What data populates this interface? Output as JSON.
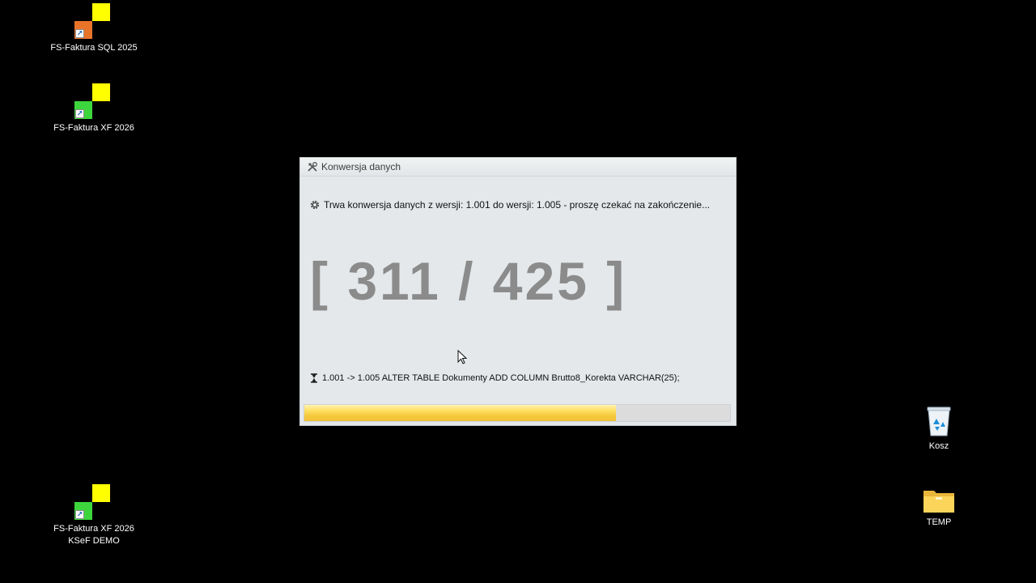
{
  "desktop_icons": {
    "icon1": {
      "label": "FS-Faktura SQL 2025",
      "corner_color": "#e8742a"
    },
    "icon2": {
      "label": "FS-Faktura XF 2026",
      "corner_color": "#3cd63c"
    },
    "icon3": {
      "label_line1": "FS-Faktura XF 2026",
      "label_line2": "KSeF DEMO",
      "corner_color": "#3cd63c"
    },
    "recycle_bin": {
      "label": "Kosz",
      "icon": "recycle-bin-icon"
    },
    "temp_folder": {
      "label": "TEMP",
      "icon": "folder-icon"
    }
  },
  "logo_colors": {
    "yellow": "#ffff00"
  },
  "dialog": {
    "title": "Konwersja danych",
    "title_icon": "tools-icon",
    "status_text": "Trwa konwersja danych z wersji: 1.001 do wersji: 1.005 - proszę czekać na zakończenie...",
    "status_icon": "gear-icon",
    "counter_text": "[ 311 / 425 ]",
    "current": 311,
    "total": 425,
    "sql_text": "1.001 -> 1.005 ALTER TABLE Dokumenty ADD COLUMN Brutto8_Korekta VARCHAR(25);",
    "sql_icon": "hourglass-icon",
    "progress_fraction": 0.732
  }
}
